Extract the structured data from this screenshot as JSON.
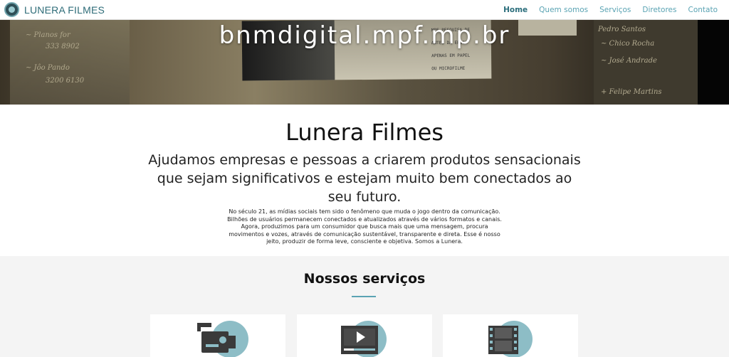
{
  "navbar": {
    "brand": "LUNERA FILMES",
    "items": [
      {
        "label": "Home",
        "active": true
      },
      {
        "label": "Quem somos",
        "active": false
      },
      {
        "label": "Serviços",
        "active": false
      },
      {
        "label": "Diretores",
        "active": false
      },
      {
        "label": "Contato",
        "active": false
      }
    ]
  },
  "hero": {
    "url_text": "bnmdigital.mpf.mp.br"
  },
  "intro": {
    "title": "Lunera Filmes",
    "subtitle": "Ajudamos empresas e pessoas a criarem produtos sensacionais que sejam significativos e estejam muito bem conectados ao seu futuro.",
    "text": "No século 21, as mídias sociais tem sido o fenômeno que muda o jogo dentro da comunicação. Bilhões de usuários permanecem conectados e atualizados através de vários formatos e canais. Agora, produzimos para um consumidor que busca mais que uma mensagem, procura movimentos e vozes, através de comunicação sustentável, transparente e direta. Esse é nosso jeito, produzir de forma leve, consciente e objetiva. Somos a Lunera."
  },
  "services": {
    "title": "Nossos serviços",
    "cards": [
      {
        "icon": "video-camera-icon"
      },
      {
        "icon": "video-player-icon"
      },
      {
        "icon": "film-strip-icon"
      }
    ]
  },
  "colors": {
    "accent": "#5aa3b3",
    "brand": "#2e6c78",
    "icon_circle": "#8dbdc6",
    "services_bg": "#f4f4f4"
  }
}
